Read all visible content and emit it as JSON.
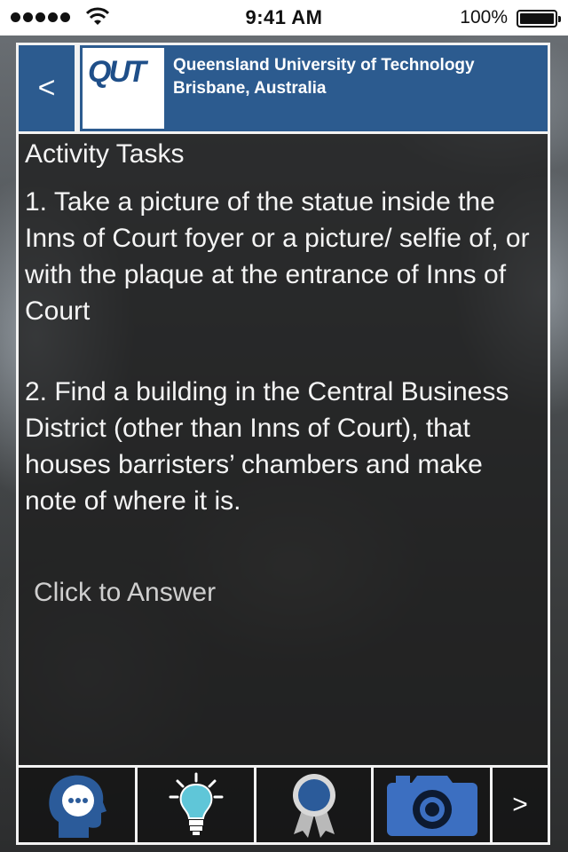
{
  "status_bar": {
    "time": "9:41 AM",
    "battery_percent": "100%",
    "signal_bars": 5
  },
  "header": {
    "back_label": "<",
    "logo_text": "QUT",
    "university_name": "Queensland University of Technology",
    "location": "Brisbane, Australia",
    "brand_color": "#2c5b8f"
  },
  "content": {
    "title": "Activity Tasks",
    "tasks": [
      "1. Take a picture of the statue inside the Inns of Court foyer or a picture/ selfie of, or with the plaque at the entrance of Inns of Court",
      "2. Find a building in the Central Business District (other than Inns of Court), that houses barristers’ chambers and make note of where it is."
    ],
    "answer_label": "Click to Answer"
  },
  "toolbar": {
    "items": [
      {
        "icon": "chat-head-icon"
      },
      {
        "icon": "lightbulb-icon"
      },
      {
        "icon": "award-ribbon-icon"
      },
      {
        "icon": "camera-icon"
      }
    ],
    "next_label": ">"
  }
}
